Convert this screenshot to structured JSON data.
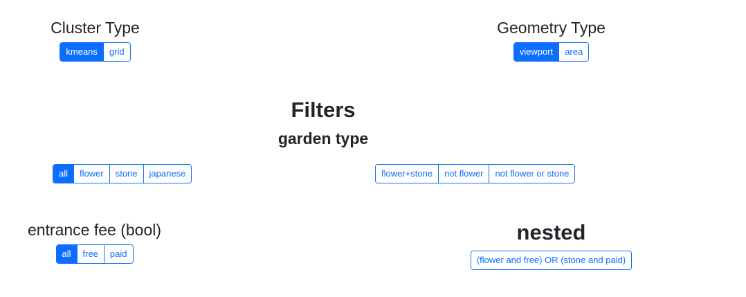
{
  "cluster_type": {
    "title": "Cluster Type",
    "options": [
      "kmeans",
      "grid"
    ],
    "active": "kmeans"
  },
  "geometry_type": {
    "title": "Geometry Type",
    "options": [
      "viewport",
      "area"
    ],
    "active": "viewport"
  },
  "filters": {
    "title": "Filters",
    "garden_type": {
      "title": "garden type",
      "basic_options": [
        "all",
        "flower",
        "stone",
        "japanese"
      ],
      "active": "all",
      "combo_options": [
        "flower+stone",
        "not flower",
        "not flower or stone"
      ]
    },
    "entrance_fee": {
      "title": "entrance fee (bool)",
      "options": [
        "all",
        "free",
        "paid"
      ],
      "active": "all"
    },
    "nested": {
      "title": "nested",
      "options": [
        "(flower and free) OR (stone and paid)"
      ]
    }
  },
  "colors": {
    "primary": "#0d6efd",
    "text": "#212529",
    "background": "#ffffff"
  }
}
